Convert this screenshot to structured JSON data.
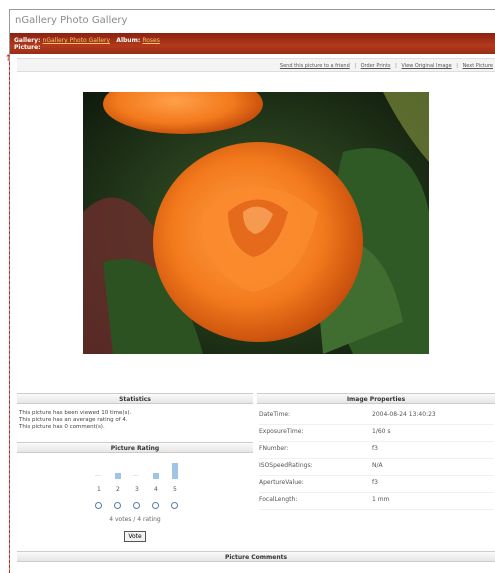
{
  "app": {
    "title": "nGallery Photo Gallery"
  },
  "breadcrumb": {
    "gallery_label": "Gallery:",
    "gallery_value": "nGallery Photo Gallery",
    "album_label": "Album:",
    "album_value": "Roses",
    "picture_label": "Picture:"
  },
  "toolbar": {
    "send": "Send this picture to a friend",
    "order": "Order Prints",
    "view": "View Original Image",
    "next": "Next Picture",
    "separator": "|"
  },
  "photo": {
    "icon": "rose-photo"
  },
  "statistics": {
    "heading": "Statistics",
    "lines": [
      "This picture has been viewed 10 time(s).",
      "This picture has an average rating of 4.",
      "This picture has 0 comment(s)."
    ]
  },
  "rating": {
    "heading": "Picture Rating",
    "labels": [
      "1",
      "2",
      "3",
      "4",
      "5"
    ],
    "bar_levels": [
      0,
      0.4,
      0,
      0.4,
      1
    ],
    "empty_mark": "...",
    "summary": "4 votes / 4 rating",
    "vote_button": "Vote"
  },
  "properties": {
    "heading": "Image Properties",
    "rows": [
      {
        "key": "DateTime:",
        "value": "2004-08-24 13:40:23"
      },
      {
        "key": "ExposureTime:",
        "value": "1/60 s"
      },
      {
        "key": "FNumber:",
        "value": "f3"
      },
      {
        "key": "ISOSpeedRatings:",
        "value": "N/A"
      },
      {
        "key": "ApertureValue:",
        "value": "f3"
      },
      {
        "key": "FocalLength:",
        "value": "1 mm"
      }
    ]
  },
  "comments": {
    "heading": "Picture Comments"
  },
  "colors": {
    "accent": "#a3301a",
    "link": "#f6c26a",
    "annotation": "#d8201d"
  }
}
